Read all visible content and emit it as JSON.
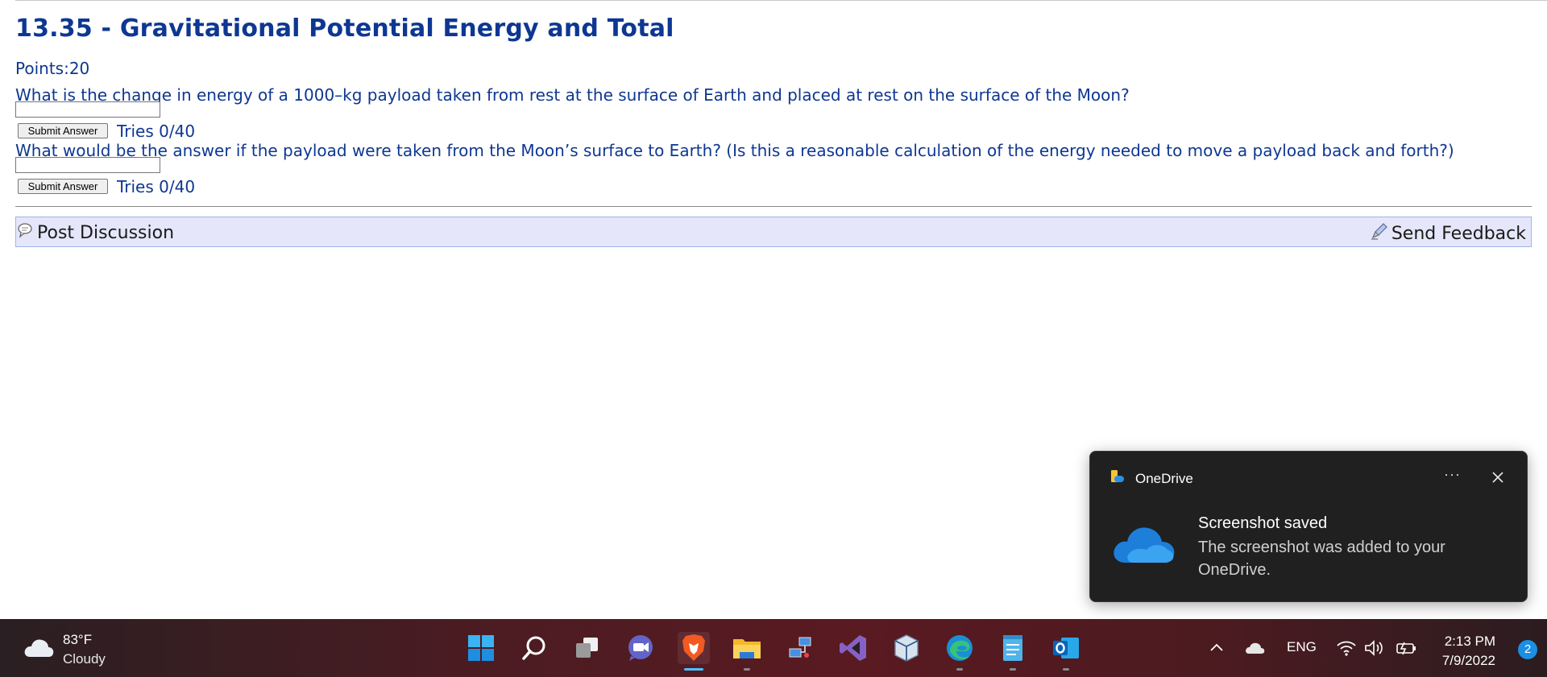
{
  "page": {
    "title": "13.35 - Gravitational Potential Energy and Total",
    "points": "Points:20",
    "questions": [
      {
        "text": "What is the change in energy of a 1000–kg payload taken from rest at the surface of Earth and placed at rest on the surface of the Moon?",
        "answer_value": "",
        "submit_label": "Submit Answer",
        "tries": "Tries 0/40"
      },
      {
        "text": "What would be the answer if the payload were taken from the Moon’s surface to Earth? (Is this a reasonable calculation of the energy needed to move a payload back and forth?)",
        "answer_value": "",
        "submit_label": "Submit Answer",
        "tries": "Tries 0/40"
      }
    ],
    "discussion_label": "Post Discussion",
    "feedback_label": "Send Feedback"
  },
  "notification": {
    "app_name": "OneDrive",
    "more_label": "···",
    "title": "Screenshot saved",
    "body": "The screenshot was added to your OneDrive."
  },
  "taskbar": {
    "weather": {
      "temp": "83°F",
      "condition": "Cloudy"
    },
    "pinned": [
      "windows-start-icon",
      "search-icon",
      "task-view-icon",
      "teams-chat-icon",
      "brave-browser-icon",
      "file-explorer-icon",
      "network-app-icon",
      "visual-studio-icon",
      "virtualbox-icon",
      "edge-browser-icon",
      "notepad-icon",
      "outlook-icon"
    ],
    "language": "ENG",
    "time": "2:13 PM",
    "date": "7/9/2022",
    "notification_count": "2"
  },
  "colors": {
    "link_blue": "#0e3792",
    "discussion_bar": "#e6e6fa",
    "toast_bg": "#202020",
    "accent": "#4cc2ff"
  }
}
